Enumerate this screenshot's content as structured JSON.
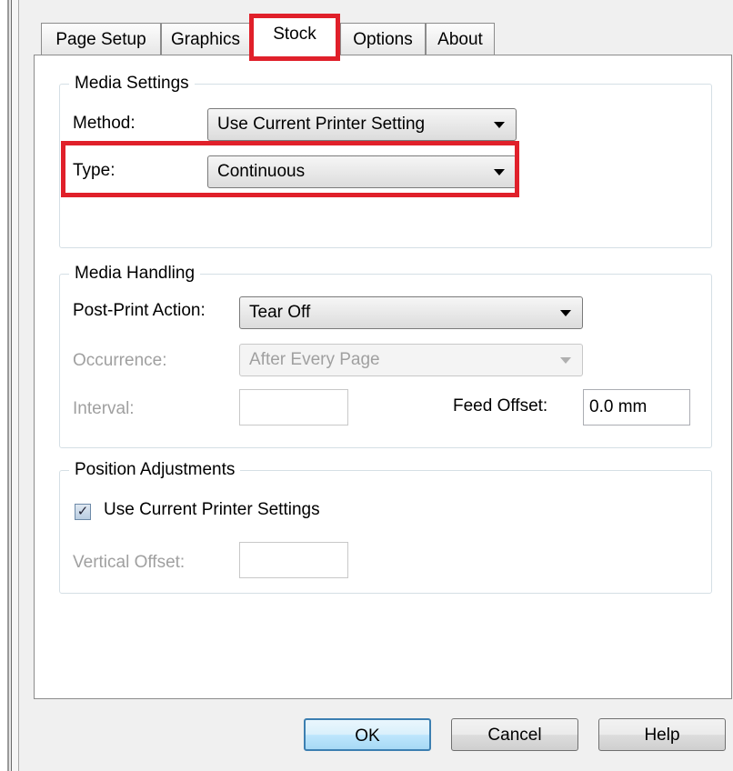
{
  "tabs": [
    {
      "label": "Page Setup",
      "active": false
    },
    {
      "label": "Graphics",
      "active": false
    },
    {
      "label": "Stock",
      "active": true
    },
    {
      "label": "Options",
      "active": false
    },
    {
      "label": "About",
      "active": false
    }
  ],
  "media_settings": {
    "title": "Media Settings",
    "method_label": "Method:",
    "method_value": "Use Current Printer Setting",
    "type_label": "Type:",
    "type_value": "Continuous"
  },
  "media_handling": {
    "title": "Media Handling",
    "post_print_label": "Post-Print Action:",
    "post_print_value": "Tear Off",
    "occurrence_label": "Occurrence:",
    "occurrence_value": "After Every Page",
    "interval_label": "Interval:",
    "interval_value": "",
    "feed_offset_label": "Feed Offset:",
    "feed_offset_value": "0.0 mm"
  },
  "position_adjustments": {
    "title": "Position Adjustments",
    "use_current_label": "Use Current Printer Settings",
    "use_current_checked": true,
    "check_glyph": "✓",
    "vertical_offset_label": "Vertical Offset:",
    "vertical_offset_value": ""
  },
  "buttons": {
    "ok": "OK",
    "cancel": "Cancel",
    "help": "Help"
  },
  "colors": {
    "highlight": "#e0202a"
  }
}
